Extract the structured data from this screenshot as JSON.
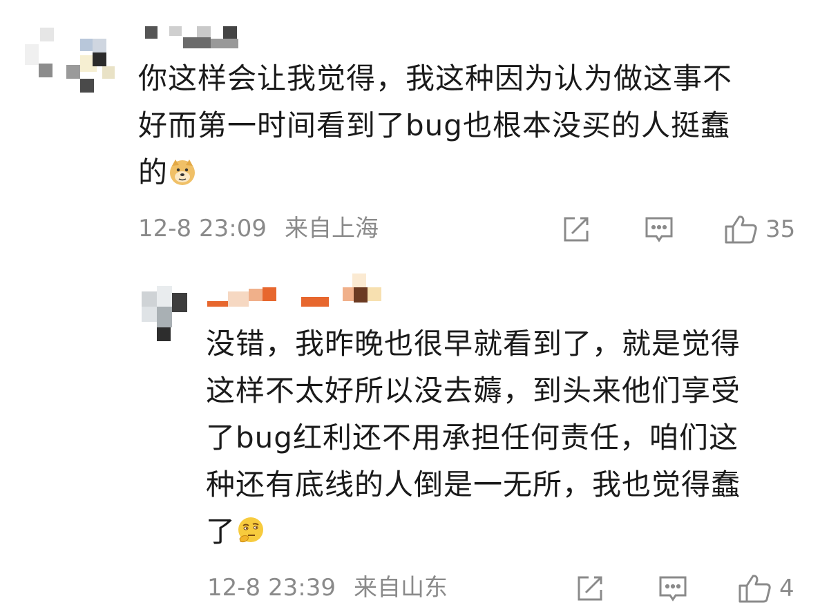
{
  "comments": [
    {
      "text_lines": [
        "你这样会让我觉得，我这种因为认为做这事不",
        "好而第一时间看到了bug也根本没买的人挺蠢",
        "的"
      ],
      "emoji_icon": "doge-emoji-icon",
      "time": "12-8 23:09",
      "location": "来自上海",
      "likes": "35"
    },
    {
      "text_lines": [
        "没错，我昨晚也很早就看到了，就是觉得",
        "这样不太好所以没去薅，到头来他们享受",
        "了bug红利还不用承担任何责任，咱们这",
        "种还有底线的人倒是一无所，我也觉得蠢",
        "了"
      ],
      "emoji_icon": "thinking-emoji-icon",
      "time": "12-8 23:39",
      "location": "来自山东",
      "likes": "4"
    }
  ],
  "colors": {
    "text": "#1a1a1a",
    "meta": "#8a8a8a",
    "icon": "#8a8a8a"
  },
  "icons": [
    "share-icon",
    "reply-icon",
    "like-icon"
  ]
}
